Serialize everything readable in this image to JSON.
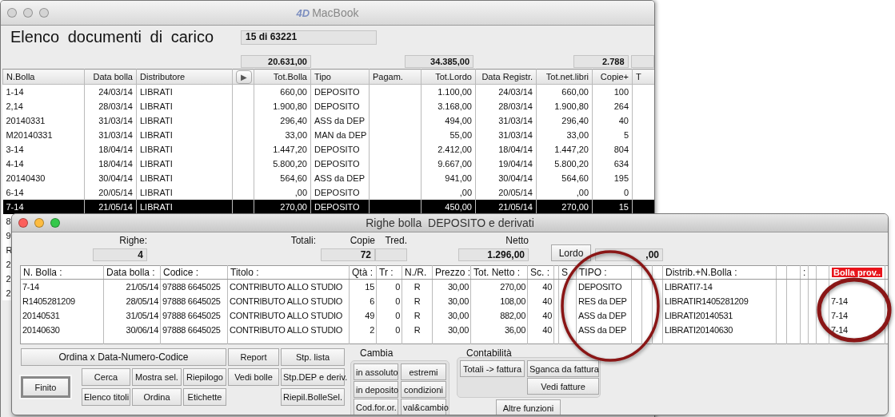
{
  "back_window": {
    "active": false,
    "logo": "4D",
    "title": "MacBook",
    "heading": "Elenco documenti di carico",
    "counter": "15 di 63221",
    "totals": [
      "20.631,00",
      "34.385,00",
      "2.788"
    ],
    "table": {
      "columns": [
        {
          "label": "N.Bolla",
          "kind": "header"
        },
        {
          "label": "Data bolla",
          "kind": "header"
        },
        {
          "label": "Distributore",
          "kind": "header"
        },
        {
          "label": "▶",
          "kind": "button"
        },
        {
          "label": "Tot.Bolla",
          "kind": "header"
        },
        {
          "label": "Tipo",
          "kind": "header"
        },
        {
          "label": "Pagam.",
          "kind": "header"
        },
        {
          "label": "Tot.Lordo",
          "kind": "header"
        },
        {
          "label": "Data Registr.",
          "kind": "header"
        },
        {
          "label": "Tot.net.libri",
          "kind": "header"
        },
        {
          "label": "Copie+",
          "kind": "header"
        },
        {
          "label": "T",
          "kind": "header"
        }
      ],
      "rows": [
        {
          "n_bolla": "1-14",
          "data_bolla": "24/03/14",
          "distributore": "LIBRATI",
          "tot_bolla": "660,00",
          "tipo": "DEPOSITO",
          "tot_lordo": "1.100,00",
          "data_registr": "24/03/14",
          "tot_net_libri": "660,00",
          "copie": "100",
          "selected": false
        },
        {
          "n_bolla": "2,14",
          "data_bolla": "28/03/14",
          "distributore": "LIBRATI",
          "tot_bolla": "1.900,80",
          "tipo": "DEPOSITO",
          "tot_lordo": "3.168,00",
          "data_registr": "28/03/14",
          "tot_net_libri": "1.900,80",
          "copie": "264",
          "selected": false
        },
        {
          "n_bolla": "20140331",
          "data_bolla": "31/03/14",
          "distributore": "LIBRATI",
          "tot_bolla": "296,40",
          "tipo": "ASS da DEP",
          "tot_lordo": "494,00",
          "data_registr": "31/03/14",
          "tot_net_libri": "296,40",
          "copie": "40",
          "selected": false
        },
        {
          "n_bolla": "M20140331",
          "data_bolla": "31/03/14",
          "distributore": "LIBRATI",
          "tot_bolla": "33,00",
          "tipo": "MAN da DEP",
          "tot_lordo": "55,00",
          "data_registr": "31/03/14",
          "tot_net_libri": "33,00",
          "copie": "5",
          "selected": false
        },
        {
          "n_bolla": "3-14",
          "data_bolla": "18/04/14",
          "distributore": "LIBRATI",
          "tot_bolla": "1.447,20",
          "tipo": "DEPOSITO",
          "tot_lordo": "2.412,00",
          "data_registr": "18/04/14",
          "tot_net_libri": "1.447,20",
          "copie": "804",
          "selected": false
        },
        {
          "n_bolla": "4-14",
          "data_bolla": "18/04/14",
          "distributore": "LIBRATI",
          "tot_bolla": "5.800,20",
          "tipo": "DEPOSITO",
          "tot_lordo": "9.667,00",
          "data_registr": "19/04/14",
          "tot_net_libri": "5.800,20",
          "copie": "634",
          "selected": false
        },
        {
          "n_bolla": "20140430",
          "data_bolla": "30/04/14",
          "distributore": "LIBRATI",
          "tot_bolla": "564,60",
          "tipo": "ASS da DEP",
          "tot_lordo": "941,00",
          "data_registr": "30/04/14",
          "tot_net_libri": "564,60",
          "copie": "195",
          "selected": false
        },
        {
          "n_bolla": "6-14",
          "data_bolla": "20/05/14",
          "distributore": "LIBRATI",
          "tot_bolla": ",00",
          "tipo": "DEPOSITO",
          "tot_lordo": ",00",
          "data_registr": "20/05/14",
          "tot_net_libri": ",00",
          "copie": "0",
          "selected": false
        },
        {
          "n_bolla": "7-14",
          "data_bolla": "21/05/14",
          "distributore": "LIBRATI",
          "tot_bolla": "270,00",
          "tipo": "DEPOSITO",
          "tot_lordo": "450,00",
          "data_registr": "21/05/14",
          "tot_net_libri": "270,00",
          "copie": "15",
          "selected": true
        },
        {
          "n_bolla": "8",
          "selected": false
        },
        {
          "n_bolla": "9",
          "selected": false
        },
        {
          "n_bolla": "R",
          "selected": false
        },
        {
          "n_bolla": "2",
          "selected": false
        },
        {
          "n_bolla": "2",
          "selected": false
        },
        {
          "n_bolla": "2",
          "selected": false
        }
      ]
    }
  },
  "detail_window": {
    "active": true,
    "title": "Righe bolla  DEPOSITO e derivati",
    "righe_label": "Righe:",
    "righe": "4",
    "totali_label": "Totali:",
    "copie_label": "Copie",
    "copie": "72",
    "tred_label": "Tred.",
    "netto_label": "Netto",
    "netto": "1.296,00",
    "lordo_button": "Lordo",
    "lordo": ",00",
    "table": {
      "columns": [
        {
          "label": "N. Bolla :",
          "kind": "plain"
        },
        {
          "label": "Data bolla :",
          "kind": "plain"
        },
        {
          "label": "Codice :",
          "kind": "plain"
        },
        {
          "label": "Titolo :",
          "kind": "plain"
        },
        {
          "label": "Qtà :",
          "kind": "plain"
        },
        {
          "label": "Tr :",
          "kind": "plain"
        },
        {
          "label": "N./R.",
          "kind": "plain"
        },
        {
          "label": "Prezzo :",
          "kind": "plain"
        },
        {
          "label": "Tot. Netto :",
          "kind": "plain"
        },
        {
          "label": "Sc. :",
          "kind": "plain"
        },
        {
          "kind": "plain"
        },
        {
          "label": "S",
          "kind": "plain"
        },
        {
          "label": "TIPO :",
          "kind": "plain"
        },
        {
          "kind": "plain"
        },
        {
          "kind": "plain"
        },
        {
          "kind": "plain"
        },
        {
          "label": "Distrib.+N.Bolla :",
          "kind": "plain"
        },
        {
          "kind": "plain"
        },
        {
          "kind": "plain"
        },
        {
          "label": ":",
          "kind": "plain"
        },
        {
          "kind": "plain"
        },
        {
          "kind": "plain"
        },
        {
          "label": "Bolla prov..",
          "kind": "highlight"
        },
        {
          "kind": "plain"
        }
      ],
      "rows": [
        {
          "n_bolla": "7-14",
          "data_bolla": "21/05/14",
          "codice": "97888 6645025",
          "titolo": "CONTRIBUTO ALLO STUDIO",
          "qta": "15",
          "tr": "0",
          "nr": "R",
          "prezzo": "30,00",
          "tot_netto": "270,00",
          "sc": "40",
          "tipo": "DEPOSITO",
          "distrib": "LIBRATI7-14"
        },
        {
          "n_bolla": "R1405281209",
          "data_bolla": "28/05/14",
          "codice": "97888 6645025",
          "titolo": "CONTRIBUTO ALLO STUDIO",
          "qta": "6",
          "tr": "0",
          "nr": "R",
          "prezzo": "30,00",
          "tot_netto": "108,00",
          "sc": "40",
          "tipo": "RES da DEP",
          "distrib": "LIBRATIR1405281209",
          "bolla_prov": "7-14"
        },
        {
          "n_bolla": "20140531",
          "data_bolla": "31/05/14",
          "codice": "97888 6645025",
          "titolo": "CONTRIBUTO ALLO STUDIO",
          "qta": "49",
          "tr": "0",
          "nr": "R",
          "prezzo": "30,00",
          "tot_netto": "882,00",
          "sc": "40",
          "tipo": "ASS da DEP",
          "distrib": "LIBRATI20140531",
          "bolla_prov": "7-14"
        },
        {
          "n_bolla": "20140630",
          "data_bolla": "30/06/14",
          "codice": "97888 6645025",
          "titolo": "CONTRIBUTO ALLO STUDIO",
          "qta": "2",
          "tr": "0",
          "nr": "R",
          "prezzo": "30,00",
          "tot_netto": "36,00",
          "sc": "40",
          "tipo": "ASS da DEP",
          "distrib": "LIBRATI20140630",
          "bolla_prov": "7-14"
        }
      ]
    },
    "buttons": [
      {
        "label": "Ordina x Data-Numero-Codice",
        "kind": "push"
      },
      {
        "label": "Report",
        "kind": "push"
      },
      {
        "label": "Stp. lista",
        "kind": "push"
      },
      {
        "label": "Finito",
        "kind": "default"
      },
      {
        "label": "Cerca",
        "kind": "push"
      },
      {
        "label": "Mostra sel.",
        "kind": "push"
      },
      {
        "label": "Riepilogo",
        "kind": "push"
      },
      {
        "label": "Vedi bolle",
        "kind": "push"
      },
      {
        "label": "Stp.DEP e deriv.",
        "kind": "push"
      },
      {
        "label": "Elenco titoli",
        "kind": "push"
      },
      {
        "label": "Ordina",
        "kind": "push"
      },
      {
        "label": "Etichette",
        "kind": "push"
      },
      {
        "label": "Riepil.BolleSel.",
        "kind": "push"
      }
    ],
    "cambia": {
      "title": "Cambia",
      "buttons": [
        "in assoluto",
        "estremi",
        "in deposito",
        "condizioni",
        "Cod.for.or.",
        "val&cambio"
      ]
    },
    "contabilita": {
      "title": "Contabilità",
      "buttons": [
        "Totali -> fattura",
        "Sganca da fattura",
        "Vedi fatture"
      ]
    },
    "altre_funzioni": "Altre funzioni"
  }
}
